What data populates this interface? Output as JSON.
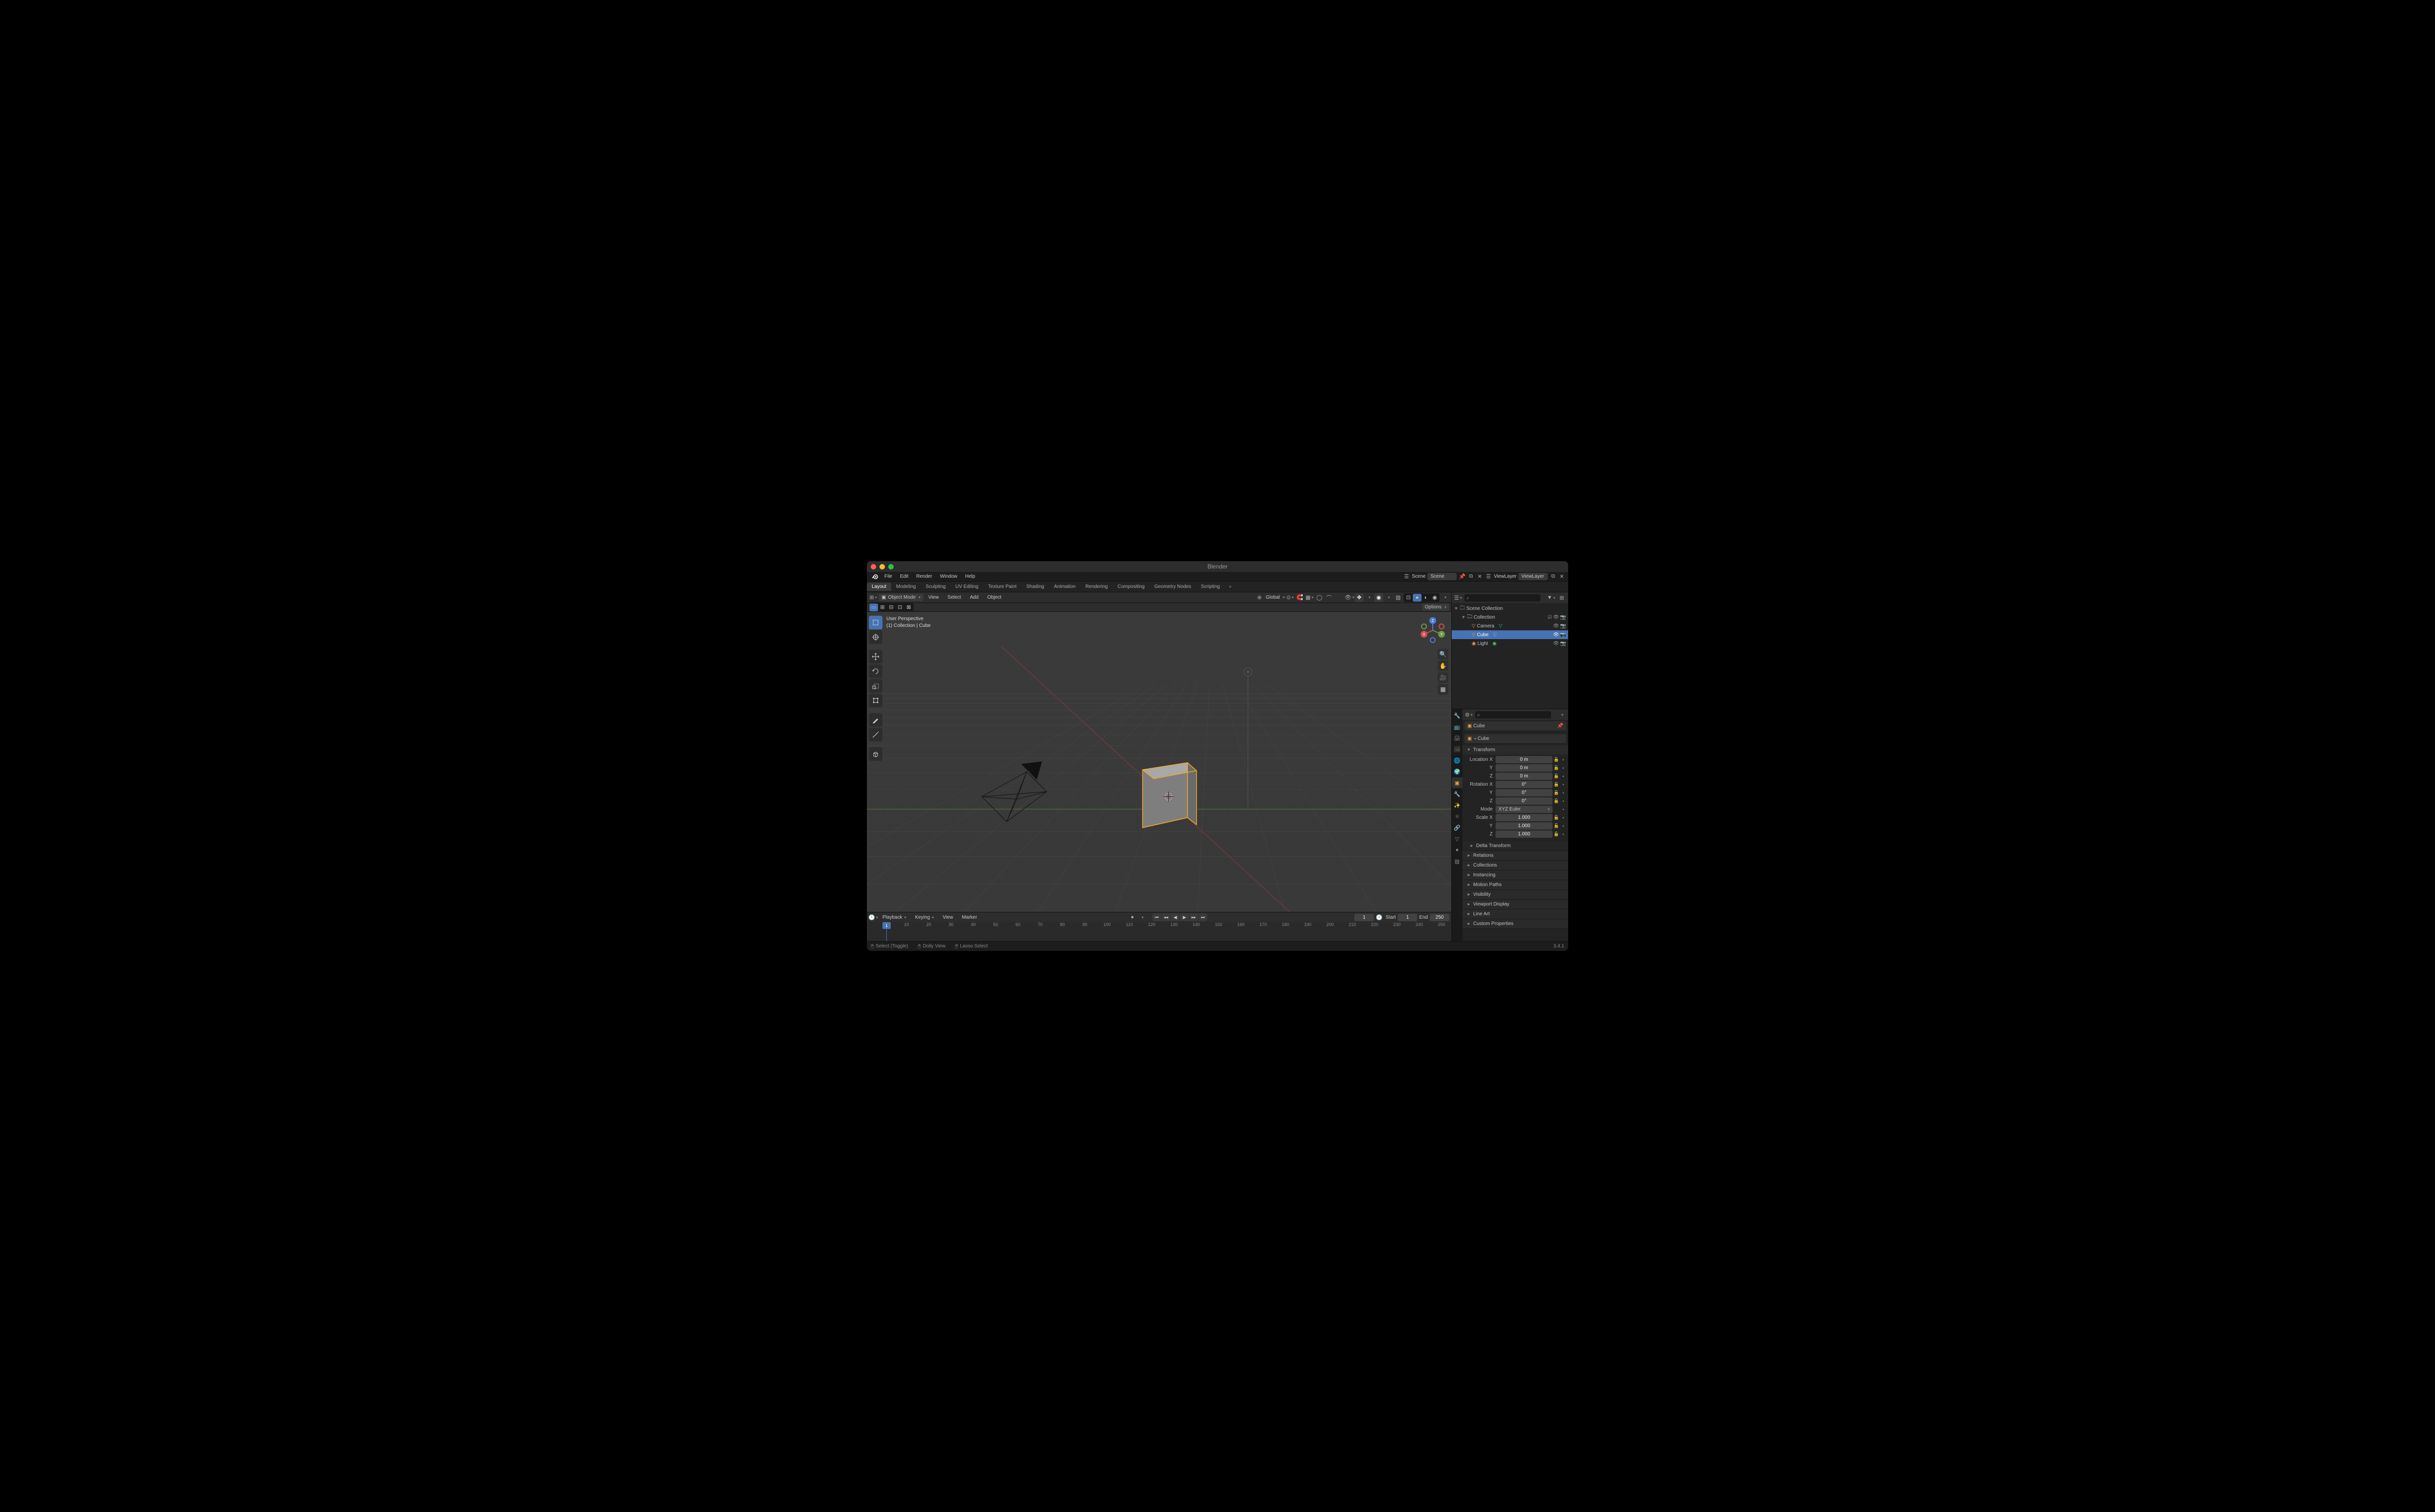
{
  "title": "Blender",
  "version": "3.4.1",
  "menubar": [
    "File",
    "Edit",
    "Render",
    "Window",
    "Help"
  ],
  "workspace_tabs": [
    "Layout",
    "Modeling",
    "Sculpting",
    "UV Editing",
    "Texture Paint",
    "Shading",
    "Animation",
    "Rendering",
    "Compositing",
    "Geometry Nodes",
    "Scripting"
  ],
  "active_workspace": "Layout",
  "topbar": {
    "scene_label": "Scene",
    "scene_value": "Scene",
    "viewlayer_label": "ViewLayer",
    "viewlayer_value": "ViewLayer"
  },
  "viewport_header": {
    "mode": "Object Mode",
    "menus": [
      "View",
      "Select",
      "Add",
      "Object"
    ],
    "orientation": "Global",
    "options_label": "Options"
  },
  "overlay": {
    "line1": "User Perspective",
    "line2": "(1) Collection | Cube"
  },
  "outliner": {
    "root": "Scene Collection",
    "items": [
      {
        "name": "Collection",
        "depth": 1,
        "type": "collection",
        "expanded": true
      },
      {
        "name": "Camera",
        "depth": 2,
        "type": "camera"
      },
      {
        "name": "Cube",
        "depth": 2,
        "type": "mesh",
        "selected": true
      },
      {
        "name": "Light",
        "depth": 2,
        "type": "light"
      }
    ]
  },
  "properties": {
    "crumb_obj": "Cube",
    "crumb_data": "Cube",
    "transform": {
      "label": "Transform",
      "location": {
        "label": "Location X",
        "y": "Y",
        "z": "Z",
        "vx": "0 m",
        "vy": "0 m",
        "vz": "0 m"
      },
      "rotation": {
        "label": "Rotation X",
        "y": "Y",
        "z": "Z",
        "vx": "0°",
        "vy": "0°",
        "vz": "0°"
      },
      "mode": {
        "label": "Mode",
        "value": "XYZ Euler"
      },
      "scale": {
        "label": "Scale X",
        "y": "Y",
        "z": "Z",
        "vx": "1.000",
        "vy": "1.000",
        "vz": "1.000"
      }
    },
    "panels": [
      "Delta Transform",
      "Relations",
      "Collections",
      "Instancing",
      "Motion Paths",
      "Visibility",
      "Viewport Display",
      "Line Art",
      "Custom Properties"
    ]
  },
  "timeline": {
    "menus": [
      "Playback",
      "Keying",
      "View",
      "Marker"
    ],
    "current": "1",
    "start_label": "Start",
    "start": "1",
    "end_label": "End",
    "end": "250",
    "ticks": [
      1,
      10,
      20,
      30,
      40,
      50,
      60,
      70,
      80,
      90,
      100,
      110,
      120,
      130,
      140,
      150,
      160,
      170,
      180,
      190,
      200,
      210,
      220,
      230,
      240,
      250
    ]
  },
  "statusbar": {
    "select": "Select (Toggle)",
    "dolly": "Dolly View",
    "lasso": "Lasso Select"
  }
}
